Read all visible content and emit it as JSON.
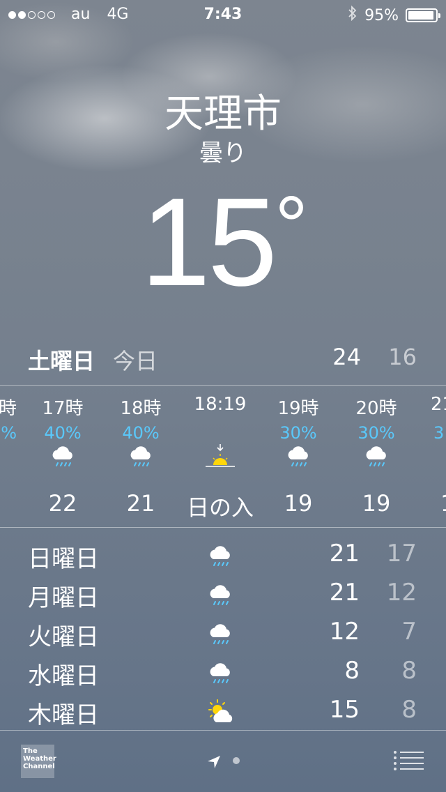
{
  "status": {
    "carrier": "au",
    "network": "4G",
    "time": "7:43",
    "battery": "95%",
    "battery_fraction": 0.95,
    "signal_bars": 2,
    "signal_total": 5
  },
  "location": {
    "city": "天理市",
    "condition": "曇り",
    "temperature": "15",
    "degree": "°"
  },
  "today": {
    "day": "土曜日",
    "label": "今日",
    "high": "24",
    "low": "16"
  },
  "hourly": [
    {
      "time": "時",
      "precip": "%",
      "icon": "rain-cloud-icon",
      "value": ""
    },
    {
      "time": "17時",
      "precip": "40%",
      "icon": "rain-cloud-icon",
      "value": "22"
    },
    {
      "time": "18時",
      "precip": "40%",
      "icon": "rain-cloud-icon",
      "value": "21"
    },
    {
      "time": "18:19",
      "precip": "",
      "icon": "sunset-icon",
      "value": "日の入"
    },
    {
      "time": "19時",
      "precip": "30%",
      "icon": "rain-cloud-icon",
      "value": "19"
    },
    {
      "time": "20時",
      "precip": "30%",
      "icon": "rain-cloud-icon",
      "value": "19"
    },
    {
      "time": "21",
      "precip": "3",
      "icon": "rain-cloud-icon",
      "value": "1"
    }
  ],
  "daily": [
    {
      "day": "日曜日",
      "icon": "rain-cloud-icon",
      "high": "21",
      "low": "17"
    },
    {
      "day": "月曜日",
      "icon": "rain-cloud-icon",
      "high": "21",
      "low": "12"
    },
    {
      "day": "火曜日",
      "icon": "rain-cloud-icon",
      "high": "12",
      "low": "7"
    },
    {
      "day": "水曜日",
      "icon": "rain-cloud-icon",
      "high": "8",
      "low": "8"
    },
    {
      "day": "木曜日",
      "icon": "partly-sunny-icon",
      "high": "15",
      "low": "8"
    }
  ],
  "footer": {
    "provider": [
      "The",
      "Weather",
      "Channel"
    ],
    "icons": [
      "weather-channel-logo",
      "location-arrow-icon",
      "page-dot",
      "list-icon"
    ]
  },
  "colors": {
    "precip": "#5ac8fa",
    "sun": "#ffd60a"
  }
}
